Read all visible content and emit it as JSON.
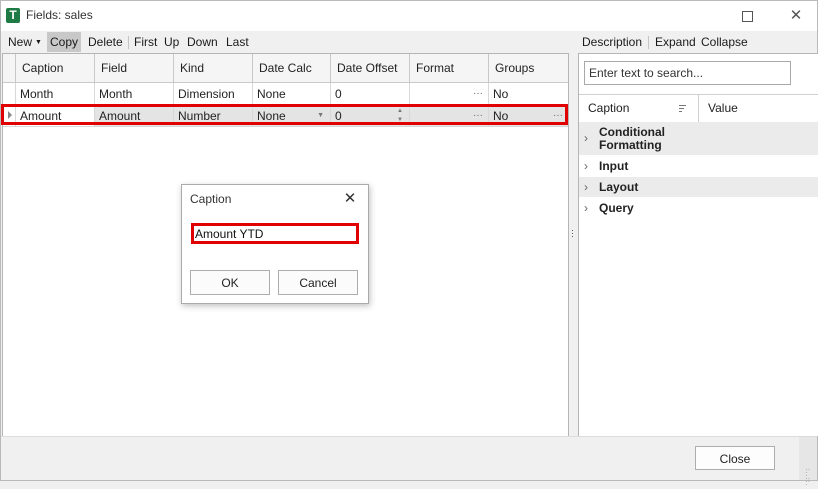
{
  "window": {
    "title": "Fields: sales",
    "app_icon": "T",
    "minimize_icon": "minimize-icon",
    "maximize_icon": "maximize-icon",
    "close_glyph": "✕"
  },
  "toolbar": {
    "new_label": "New",
    "copy_label": "Copy",
    "delete_label": "Delete",
    "first_label": "First",
    "up_label": "Up",
    "down_label": "Down",
    "last_label": "Last"
  },
  "grid": {
    "columns": [
      "Caption",
      "Field",
      "Kind",
      "Date Calc",
      "Date Offset",
      "Format",
      "Groups"
    ],
    "rows": [
      [
        "Month",
        "Month",
        "Dimension",
        "None",
        "0",
        "",
        "No"
      ],
      [
        "Amount",
        "Amount",
        "Number",
        "None",
        "0",
        "",
        "No"
      ]
    ],
    "selected_row": 1,
    "highlight_color": "#e00000"
  },
  "properties": {
    "description_label": "Description",
    "expand_label": "Expand",
    "collapse_label": "Collapse",
    "search_placeholder": "Enter text to search...",
    "caption_header": "Caption",
    "value_header": "Value",
    "categories": [
      "Conditional Formatting",
      "Input",
      "Layout",
      "Query"
    ]
  },
  "footer": {
    "close_label": "Close"
  },
  "dialog": {
    "title": "Caption",
    "input_value": "Amount YTD",
    "ok_label": "OK",
    "cancel_label": "Cancel"
  }
}
